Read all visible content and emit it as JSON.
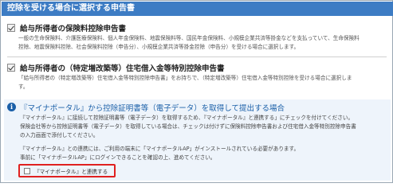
{
  "header": {
    "title": "控除を受ける場合に選択する申告書"
  },
  "forms": [
    {
      "checked": true,
      "title": "給与所得者の保険料控除申告書",
      "description_lines": [
        "一般の生命保険料、介護医療保険料、個人年金保険料、地震保険料等、国民年金保険料、小規模企業共済等掛金などを支払っていて、生命保険料",
        "控除、地震保険料控除、社会保険料控除（申告分）、小規模企業共済等掛金控除（申告分）を受ける場合に選択します。"
      ]
    },
    {
      "checked": true,
      "title": "給与所得者の（特定増改築等）住宅借入金等特別控除申告書",
      "description_lines": [
        "「給与所得者の（特定増改築等）住宅借入金等特別控除申告書」をお持ちで、（特定増改築等）住宅借入金等特別控除を受ける場合に選択しま",
        "す。"
      ]
    }
  ],
  "mynaportal": {
    "icon": "info-icon",
    "title": "『マイナポータル』から控除証明書等（電子データ）を取得して提出する場合",
    "paragraph1": [
      "『マイナポータル』に接続して控除証明書等（電子データ）を取得するため、『マイナポータル』と連携する」にチェックを付けてください。",
      "保険会社等から控除証明書等（電子データ）を取得している場合は、チェックは付けずに保険料控除申告書および住宅借入金等特別控除申告書",
      "の入力画面で添付してください。"
    ],
    "paragraph2": [
      "『マイナポータル』との連携には、ご利用の端末に「マイナポータルAP」がインストールされている必要があります。",
      "事前に「マイナポータルAP」にログインできることを確認の上、進めてください。"
    ],
    "link_checkbox": {
      "checked": false,
      "label": "『マイナポータル』と連携する"
    }
  },
  "colors": {
    "header_bg": "#3d7cc4",
    "accent_blue": "#1a5fa8",
    "info_panel_bg": "#eef4fb",
    "highlight_red": "#e02020"
  }
}
